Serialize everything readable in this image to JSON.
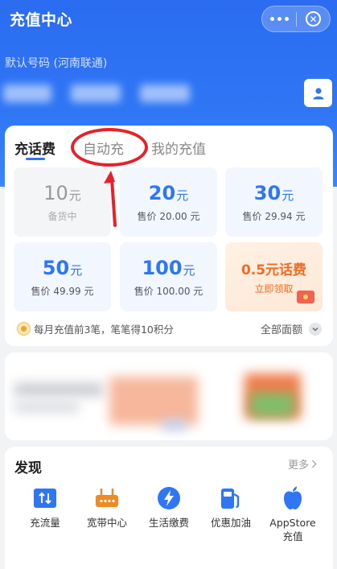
{
  "header": {
    "title": "充值中心",
    "account_label": "默认号码 (河南联通)",
    "phone_number_redacted": true
  },
  "colors": {
    "brand_blue": "#2f76f5",
    "promo_orange": "#f26b23",
    "annotation_red": "#e8202a"
  },
  "tabs": [
    {
      "label": "充话费",
      "active": true
    },
    {
      "label": "自动充",
      "active": false,
      "annotated": true
    },
    {
      "label": "我的充值",
      "active": false
    }
  ],
  "amounts": [
    {
      "amount": "10",
      "unit": "元",
      "sub": "备货中",
      "disabled": true
    },
    {
      "amount": "20",
      "unit": "元",
      "sub": "售价 20.00 元",
      "disabled": false
    },
    {
      "amount": "30",
      "unit": "元",
      "sub": "售价 29.94 元",
      "disabled": false
    },
    {
      "amount": "50",
      "unit": "元",
      "sub": "售价 49.99 元",
      "disabled": false
    },
    {
      "amount": "100",
      "unit": "元",
      "sub": "售价 100.00 元",
      "disabled": false
    }
  ],
  "promo": {
    "title": "0.5元话费",
    "subtitle": "立即领取",
    "icon": "red-envelope-icon"
  },
  "points_note": "每月充值前3笔，笔笔得10积分",
  "all_amounts_label": "全部面额",
  "discover": {
    "title": "发现",
    "more_label": "更多",
    "items": [
      {
        "label": "充流量",
        "icon": "data-traffic-icon"
      },
      {
        "label": "宽带中心",
        "icon": "router-icon"
      },
      {
        "label": "生活缴费",
        "icon": "lightning-icon"
      },
      {
        "label": "优惠加油",
        "icon": "fuel-pump-icon"
      },
      {
        "label": "AppStore\n充值",
        "icon": "apple-icon"
      }
    ]
  }
}
